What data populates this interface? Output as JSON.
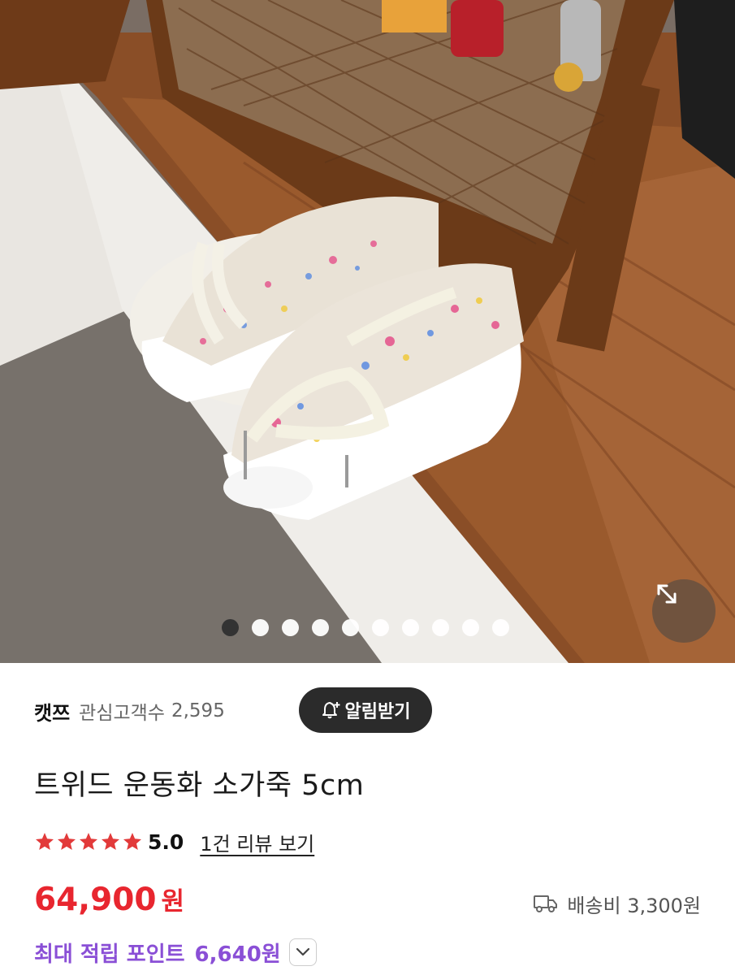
{
  "gallery": {
    "total_slides": 10,
    "active_index": 0,
    "expand_icon": "expand-arrows-icon"
  },
  "store": {
    "name": "캣쯔",
    "follower_label": "관심고객수",
    "follower_count": "2,595",
    "alarm_label": "알림받기",
    "alarm_icon": "bell-plus-icon"
  },
  "product": {
    "title": "트위드 운동화 소가죽 5cm",
    "rating_value": "5.0",
    "stars": 5,
    "review_link": "1건 리뷰 보기",
    "price": "64,900",
    "price_unit": "원",
    "shipping_label": "배송비 3,300원",
    "shipping_icon": "truck-icon",
    "points_label": "최대 적립 포인트",
    "points_value": "6,640원",
    "points_toggle_icon": "chevron-down-icon"
  },
  "colors": {
    "price": "#e8262f",
    "points": "#8a4fd6",
    "star": "#e23a3a",
    "alarm_bg": "#2b2b2b"
  }
}
